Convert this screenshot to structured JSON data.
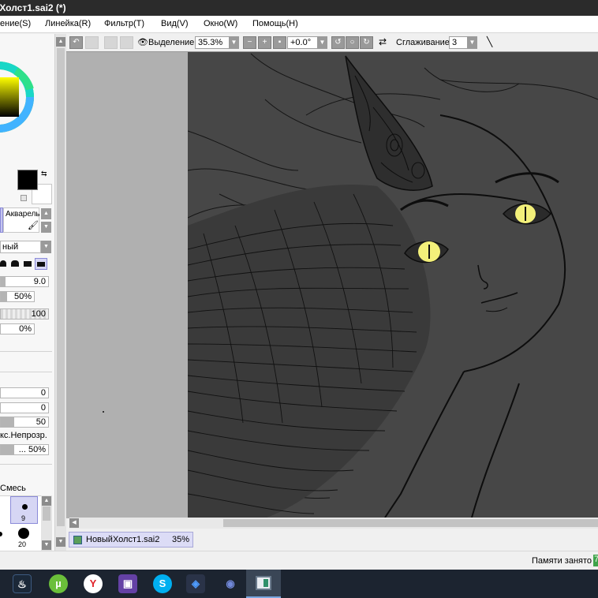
{
  "window": {
    "title": " Холст1.sai2 (*)"
  },
  "menu": {
    "items": [
      "ение(S)",
      "Линейка(R)",
      "Фильтр(T)",
      "Вид(V)",
      "Окно(W)",
      "Помощь(H)"
    ]
  },
  "toolbar": {
    "selection_label": "Выделение",
    "zoom_value": "35.3%",
    "rotation_value": "+0.0°",
    "smoothing_label": "Сглаживание",
    "smoothing_value": "3"
  },
  "left_panel": {
    "brush_name": "Акварель",
    "blend_mode": "ный",
    "size_value": "9.0",
    "min_size_value": "50%",
    "density_value": "100",
    "min_density_value": "0%",
    "param_a_value": "0",
    "param_b_value": "0",
    "param_c_value": "50",
    "opacity_label": "кс.Непрозр.",
    "opacity_value": "... 50%",
    "mix_label": "Смесь",
    "brush_sizes": [
      "9",
      "20"
    ],
    "size_fill": 0.1,
    "min_size_fill": 0.5,
    "param_c_fill": 0.5,
    "opacity_fill": 0.5,
    "primary_color": "#000000",
    "secondary_color": "#ffffff"
  },
  "document": {
    "tab_name": "НовыйХолст1.sai2",
    "tab_zoom": "35%"
  },
  "status": {
    "memory_label": "Памяти занято",
    "memory_value": "7"
  },
  "taskbar": {
    "icons": [
      "steam-icon",
      "utorrent-icon",
      "yandex-browser-icon",
      "twitch-icon",
      "skype-icon",
      "discord-icon-alt",
      "discord-icon",
      "paint-tool-sai-icon"
    ]
  },
  "colors": {
    "canvas_bg": "#474747",
    "eye_glow": "#f3f07a",
    "accent": "#5a5ad0"
  }
}
